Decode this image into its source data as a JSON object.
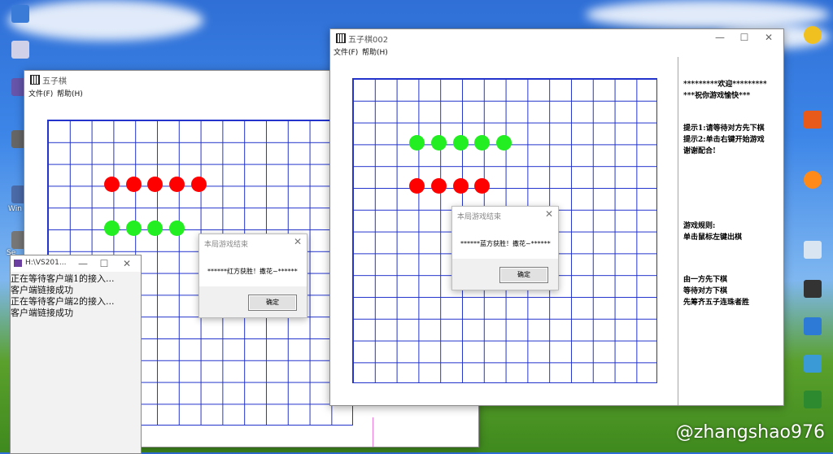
{
  "window1": {
    "title": "五子棋",
    "menu": [
      "文件(F)",
      "帮助(H)"
    ],
    "dialog": {
      "title": "本局游戏结束",
      "message": "******红方获胜！撒花~******",
      "ok": "确定"
    }
  },
  "window2": {
    "title": "五子棋002",
    "menu": [
      "文件(F)",
      "帮助(H)"
    ],
    "dialog": {
      "title": "本局游戏结束",
      "message": "******蓝方获胜！撒花~******",
      "ok": "确定"
    },
    "side": {
      "welcome1": "*********欢迎*********",
      "welcome2": "***祝你游戏愉快***",
      "tip1": "提示1:请等待对方先下棋",
      "tip2a": "提示2:单击右键开始游戏",
      "tip2b": "谢谢配合!",
      "rules_title": "游戏规则:",
      "rules_line": "单击鼠标左键出棋",
      "turn1": "由一方先下棋",
      "turn2": "等待对方下棋",
      "turn3": "先筹齐五子连珠者胜"
    }
  },
  "console": {
    "title": "H:\\VS201...",
    "lines": [
      "正在等待客户端1的接入...",
      "客户端链接成功",
      "正在等待客户端2的接入...",
      "客户端链接成功"
    ]
  },
  "desktop": {
    "labels": [
      "Win",
      "Se"
    ]
  },
  "watermark": "@zhangshao976",
  "colors": {
    "red": "#ff0000",
    "green": "#22ee22",
    "grid": "#2233cc",
    "divider": "#ee77dd"
  }
}
